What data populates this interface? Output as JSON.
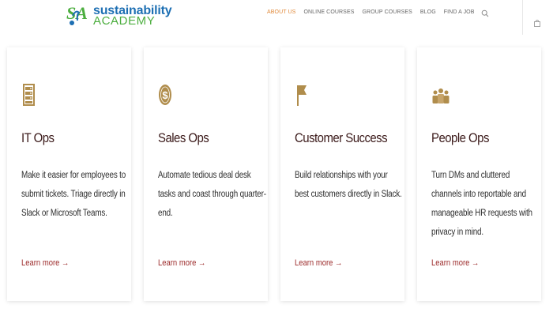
{
  "logo": {
    "mark": "SA",
    "word1": "sustainability",
    "word2": "ACADEMY"
  },
  "nav": [
    {
      "label": "ABOUT US",
      "active": true
    },
    {
      "label": "ONLINE COURSES",
      "active": false
    },
    {
      "label": "GROUP COURSES",
      "active": false
    },
    {
      "label": "BLOG",
      "active": false
    },
    {
      "label": "FIND A JOB",
      "active": false
    }
  ],
  "icons": {
    "search": "search-icon",
    "cart": "shopping-bag-icon"
  },
  "colors": {
    "accent_nav": "#e0893a",
    "icon_gold": "#b08d4c",
    "title": "#3b1a1a",
    "link": "#9c2b2b"
  },
  "cards": [
    {
      "title": "IT Ops",
      "desc": "Make it easier for employees to submit tickets. Triage directly in Slack or Microsoft Teams.",
      "link": "Learn more →",
      "icon": "server-icon"
    },
    {
      "title": "Sales Ops",
      "desc": "Automate tedious deal desk tasks and coast through quarter-end.",
      "link": "Learn more →",
      "icon": "dollar-coin-icon"
    },
    {
      "title": "Customer Success",
      "desc": "Build relationships with your best customers directly in Slack.",
      "link": "Learn more →",
      "icon": "flag-icon"
    },
    {
      "title": "People Ops",
      "desc": "Turn DMs and cluttered channels into reportable and manageable HR requests with privacy in mind.",
      "link": "Learn more →",
      "icon": "people-group-icon"
    }
  ]
}
